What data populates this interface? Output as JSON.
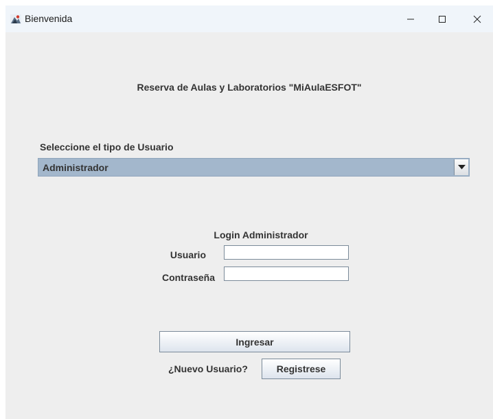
{
  "window": {
    "title": "Bienvenida",
    "controls": {
      "minimize": "minimize-icon",
      "maximize": "maximize-icon",
      "close": "close-icon"
    }
  },
  "main": {
    "heading": "Reserva de Aulas y Laboratorios \"MiAulaESFOT\"",
    "user_type_label": "Seleccione el tipo de Usuario",
    "user_type_selected": "Administrador"
  },
  "login": {
    "title": "Login Administrador",
    "user_label": "Usuario",
    "user_value": "",
    "password_label": "Contraseña",
    "password_value": "",
    "submit_label": "Ingresar",
    "new_user_text": "¿Nuevo Usuario?",
    "register_label": "Registrese"
  },
  "colors": {
    "combo_bg": "#a3b7cc",
    "window_bg": "#eeeeee",
    "titlebar_bg": "#f0f5fa"
  }
}
